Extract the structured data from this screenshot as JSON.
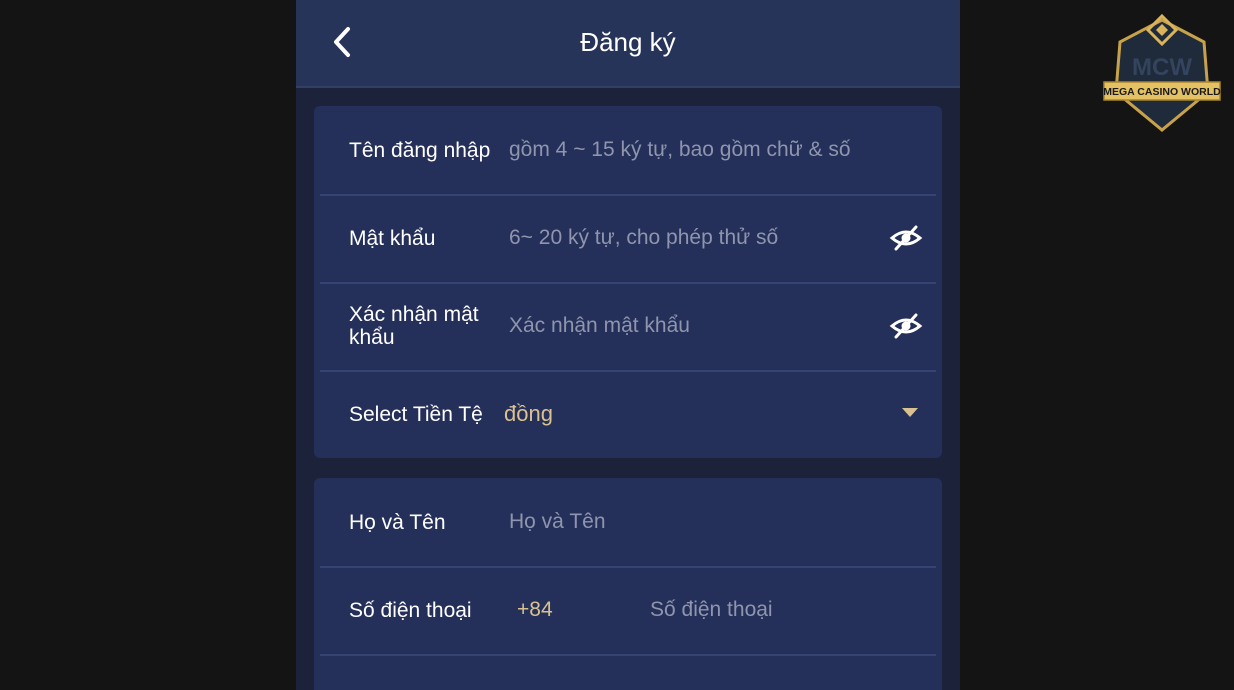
{
  "header": {
    "title": "Đăng ký",
    "back_icon": "chevron-left-icon"
  },
  "account_section": {
    "username": {
      "label": "Tên đăng nhập",
      "placeholder": "gồm 4 ~ 15 ký tự, bao gồm chữ & số"
    },
    "password": {
      "label": "Mật khẩu",
      "placeholder": "6~ 20 ký tự, cho phép thử số",
      "toggle_icon": "eye-slash-icon"
    },
    "confirm_password": {
      "label": "Xác nhận mật khẩu",
      "placeholder": "Xác nhận mật khẩu",
      "toggle_icon": "eye-slash-icon"
    },
    "currency": {
      "label": "Select Tiền Tệ",
      "value": "đồng",
      "dropdown_icon": "caret-down-icon"
    }
  },
  "personal_section": {
    "full_name": {
      "label": "Họ và Tên",
      "placeholder": "Họ và Tên"
    },
    "phone": {
      "label": "Số điện thoại",
      "country_code": "+84",
      "placeholder": "Số điện thoại"
    }
  },
  "watermark": {
    "brand_short": "MCW",
    "brand_name": "MEGA CASINO WORLD"
  },
  "colors": {
    "page_background": "#141414",
    "panel_background": "#1b2239",
    "header_background": "#273459",
    "card_background": "#25305a",
    "divider": "#344372",
    "accent_gold": "#d9c28f",
    "placeholder_text": "#8e95ad"
  }
}
